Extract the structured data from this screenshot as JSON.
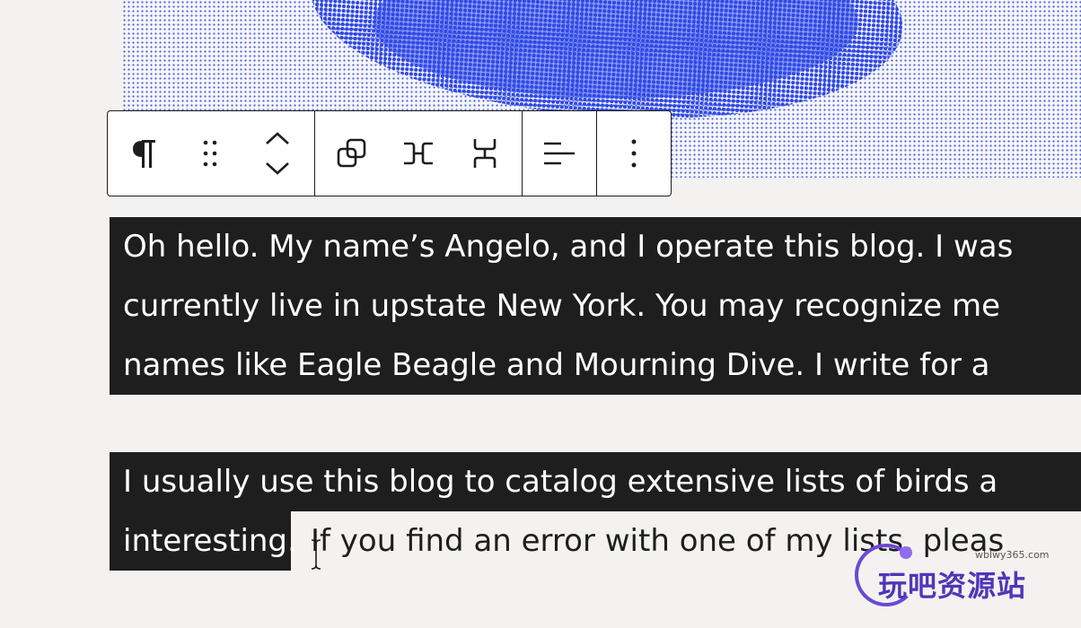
{
  "toolbar": {
    "groups": [
      {
        "buttons": [
          "paragraph-icon",
          "drag-handle-icon",
          "move-up-down-icon"
        ]
      },
      {
        "buttons": [
          "duplicate-icon",
          "justify-space-between-icon",
          "stack-icon"
        ]
      },
      {
        "buttons": [
          "align-left-icon"
        ]
      },
      {
        "buttons": [
          "more-options-icon"
        ]
      }
    ]
  },
  "content": {
    "paragraph1": {
      "lines": [
        "Oh hello. My name’s Angelo, and I operate this blog. I was",
        "currently live in upstate New York. You may recognize me",
        "names like Eagle Beagle and Mourning Dive. I write for a"
      ]
    },
    "paragraph2": {
      "line1": "I usually use this blog to catalog extensive lists of birds a",
      "line2_selected": "interesting.",
      "line2_unselected": "If you find an error with one of my lists, pleas"
    }
  },
  "watermark": {
    "small_text": "wblwy365.com",
    "text": "玩吧资源站"
  },
  "colors": {
    "selection": "#1e1e1e",
    "background": "#f3f2f0",
    "halftone": "#2f48e6"
  }
}
